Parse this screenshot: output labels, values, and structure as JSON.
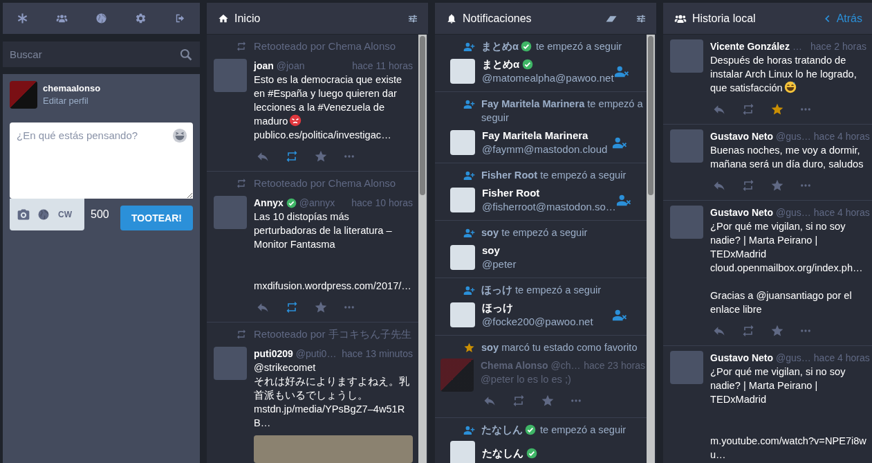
{
  "search": {
    "placeholder": "Buscar"
  },
  "account": {
    "username": "chemaalonso",
    "edit_link": "Editar perfil"
  },
  "compose": {
    "placeholder": "¿En qué estás pensando?",
    "cw_label": "CW",
    "counter": "500",
    "submit": "TOOTEAR!"
  },
  "columns": [
    {
      "kind": "home",
      "title": "Inicio",
      "statuses": [
        {
          "boost_text": "Retooteado por Chema Alonso",
          "name": "joan",
          "verified": false,
          "handle": "@joan",
          "time": "hace 11 horas",
          "content": [
            {
              "kind": "text",
              "text": "Esto es la democracia que existe en #España y luego quieren dar lecciones a la #Venezuela de maduro"
            },
            {
              "kind": "anger"
            },
            {
              "kind": "link",
              "text": "publico.es/politica/investigac…"
            }
          ],
          "media": false,
          "boosted": true,
          "favourited": false
        },
        {
          "boost_text": "Retooteado por Chema Alonso",
          "name": "Annyx",
          "verified": true,
          "handle": "@annyx",
          "time": "hace 10 horas",
          "content": [
            {
              "kind": "text",
              "text": "Las 10 distopías más perturbadoras de la literatura – Monitor Fantasma"
            },
            {
              "kind": "br"
            },
            {
              "kind": "br"
            },
            {
              "kind": "br"
            },
            {
              "kind": "link",
              "text": "mxdifusion.wordpress.com/2017/…"
            }
          ],
          "media": false,
          "boosted": true,
          "favourited": false
        },
        {
          "boost_text": "Retooteado por 手コキちん子先生",
          "name": "puti0209",
          "verified": false,
          "handle": "@puti0…",
          "time": "hace 13 minutos",
          "content": [
            {
              "kind": "mention",
              "text": "@strikecomet"
            },
            {
              "kind": "br"
            },
            {
              "kind": "text",
              "text": "それは好みによりますよねえ。乳首派もいるでしょうし。"
            },
            {
              "kind": "br"
            },
            {
              "kind": "link",
              "text": "mstdn.jp/media/YPsBgZ7–4w51RB…"
            }
          ],
          "media": true
        }
      ]
    },
    {
      "kind": "notifications",
      "title": "Notificaciones",
      "notifications": [
        {
          "kind": "follow",
          "account": "まとめα",
          "verified": true,
          "message": "te empezó a seguir",
          "name": "まとめα",
          "handle": "@matomealpha@pawoo.net",
          "unfollow_button": true
        },
        {
          "kind": "follow",
          "account": "Fay Maritela Marinera",
          "verified": false,
          "message": "te empezó a seguir",
          "name": "Fay Maritela Marinera",
          "handle": "@faymm@mastodon.cloud",
          "unfollow_button": true
        },
        {
          "kind": "follow",
          "account": "Fisher Root",
          "verified": false,
          "message": "te empezó a seguir",
          "name": "Fisher Root",
          "handle": "@fisherroot@mastodon.so…",
          "unfollow_button": true
        },
        {
          "kind": "follow",
          "account": "soy",
          "verified": false,
          "message": "te empezó a seguir",
          "name": "soy",
          "handle": "@peter",
          "unfollow_button": false
        },
        {
          "kind": "follow",
          "account": "ほっけ",
          "verified": false,
          "message": "te empezó a seguir",
          "name": "ほっけ",
          "handle": "@focke200@pawoo.net",
          "unfollow_button": true
        },
        {
          "kind": "favourite",
          "account": "soy",
          "verified": false,
          "message": "marcó tu estado como favorito",
          "status": {
            "name": "Chema Alonso",
            "verified": false,
            "handle": "@ch…",
            "time": "hace 23 horas",
            "content": [
              {
                "kind": "text",
                "text": "@peter lo es lo es ;)"
              }
            ],
            "media": false,
            "boosted": false,
            "favourited": false
          }
        },
        {
          "kind": "follow",
          "account": "たなしん",
          "verified": true,
          "message": "te empezó a seguir",
          "name": "たなしん",
          "unfollow_button": false
        }
      ]
    },
    {
      "kind": "local",
      "title": "Historia local",
      "back": "Atrás",
      "statuses": [
        {
          "name": "Vicente González",
          "verified": false,
          "handle": "…",
          "time": "hace 2 horas",
          "content": [
            {
              "kind": "text",
              "text": "Después de horas tratando de instalar Arch Linux lo he logrado, que satisfacción"
            },
            {
              "kind": "grin"
            }
          ],
          "media": false,
          "boosted": false,
          "favourited": true
        },
        {
          "name": "Gustavo Neto",
          "verified": false,
          "handle": "@gus…",
          "time": "hace 4 horas",
          "content": [
            {
              "kind": "text",
              "text": "Buenas noches, me voy a dormir, mañana será un día duro, saludos"
            }
          ],
          "media": false,
          "boosted": false,
          "favourited": false
        },
        {
          "name": "Gustavo Neto",
          "verified": false,
          "handle": "@gus…",
          "time": "hace 4 horas",
          "content": [
            {
              "kind": "text",
              "text": "¿Por qué me vigilan, si no soy nadie? | Marta Peirano | TEDxMadrid"
            },
            {
              "kind": "br"
            },
            {
              "kind": "link",
              "text": "cloud.openmailbox.org/index.ph…"
            },
            {
              "kind": "br"
            },
            {
              "kind": "br"
            },
            {
              "kind": "text",
              "text": "Gracias a "
            },
            {
              "kind": "mention",
              "text": "@juansantiago"
            },
            {
              "kind": "text",
              "text": " por el enlace libre"
            }
          ],
          "media": false,
          "boosted": false,
          "favourited": false
        },
        {
          "name": "Gustavo Neto",
          "verified": false,
          "handle": "@gus…",
          "time": "hace 4 horas",
          "content": [
            {
              "kind": "text",
              "text": "¿Por qué me vigilan, si no soy nadie? | Marta Peirano | TEDxMadrid"
            },
            {
              "kind": "br"
            },
            {
              "kind": "br"
            },
            {
              "kind": "br"
            },
            {
              "kind": "link",
              "text": "m.youtube.com/watch?v=NPE7i8wu…"
            }
          ],
          "media": false
        }
      ]
    }
  ]
}
